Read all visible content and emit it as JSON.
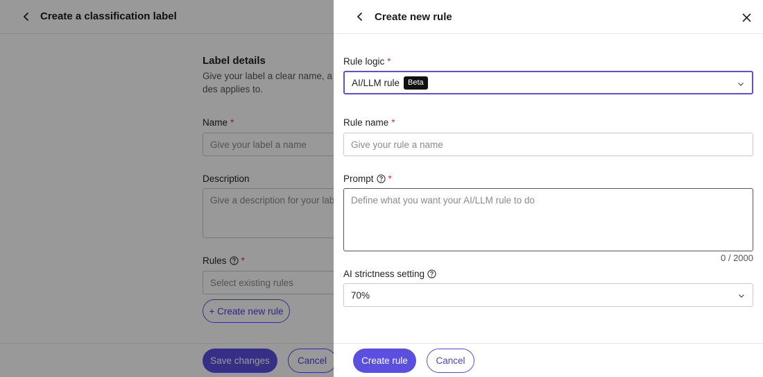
{
  "background_page": {
    "title": "Create a classification label",
    "section_title": "Label details",
    "section_description": "Give your label a clear name, a des applies to.",
    "name_label": "Name",
    "name_placeholder": "Give your label a name",
    "description_label": "Description",
    "description_placeholder": "Give a description for your label",
    "rules_label": "Rules",
    "rules_placeholder": "Select existing rules",
    "create_new_rule_label": "+ Create new rule",
    "save_label": "Save changes",
    "cancel_label": "Cancel"
  },
  "drawer": {
    "title": "Create new rule",
    "rule_logic_label": "Rule logic",
    "rule_logic_value": "AI/LLM rule",
    "rule_logic_badge": "Beta",
    "rule_name_label": "Rule name",
    "rule_name_placeholder": "Give your rule a name",
    "prompt_label": "Prompt",
    "prompt_placeholder": "Define what you want your AI/LLM rule to do",
    "prompt_counter": "0 / 2000",
    "strictness_label": "AI strictness setting",
    "strictness_value": "70%",
    "create_label": "Create rule",
    "cancel_label": "Cancel"
  },
  "required_marker": "*",
  "colors": {
    "accent": "#5b4fe0",
    "required": "#d0342c",
    "overlay": "rgba(0,0,0,0.40)"
  },
  "icons": [
    "back-arrow-icon",
    "close-icon",
    "help-icon",
    "chevron-down-icon"
  ]
}
